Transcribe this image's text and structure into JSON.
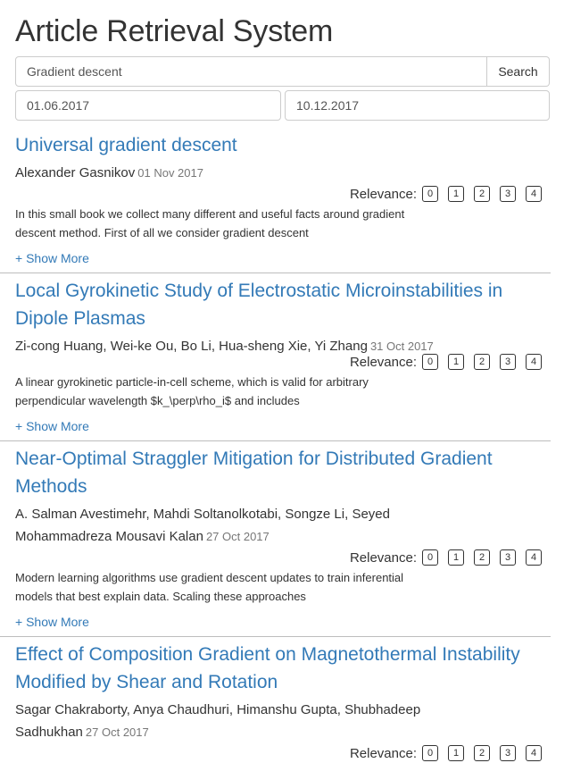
{
  "app": {
    "title": "Article Retrieval System"
  },
  "search": {
    "query": "Gradient descent",
    "button_label": "Search"
  },
  "dates": {
    "from": "01.06.2017",
    "to": "10.12.2017"
  },
  "relevance": {
    "label": "Relevance:",
    "options": [
      "0",
      "1",
      "2",
      "3",
      "4"
    ]
  },
  "results": [
    {
      "title": "Universal gradient descent",
      "authors": "Alexander Gasnikov",
      "date": "01 Nov 2017",
      "abstract": "In this small book we collect many different and useful facts around gradient descent method. First of all we consider gradient descent",
      "show_more": "+ Show More"
    },
    {
      "title": "Local Gyrokinetic Study of Electrostatic Microinstabilities in Dipole Plasmas",
      "authors": "Zi-cong Huang, Wei-ke Ou, Bo Li, Hua-sheng Xie, Yi Zhang",
      "date": "31 Oct 2017",
      "abstract": "A linear gyrokinetic particle-in-cell scheme, which is valid for arbitrary perpendicular wavelength $k_\\perp\\rho_i$ and includes",
      "show_more": "+ Show More"
    },
    {
      "title": "Near-Optimal Straggler Mitigation for Distributed Gradient Methods",
      "authors": "A. Salman Avestimehr, Mahdi Soltanolkotabi, Songze Li, Seyed Mohammadreza Mousavi Kalan",
      "date": "27 Oct 2017",
      "abstract": "Modern learning algorithms use gradient descent updates to train inferential models that best explain data. Scaling these approaches",
      "show_more": "+ Show More"
    },
    {
      "title": "Effect of Composition Gradient on Magnetothermal Instability Modified by Shear and Rotation",
      "authors": "Sagar Chakraborty, Anya Chaudhuri, Himanshu Gupta, Shubhadeep Sadhukhan",
      "date": "27 Oct 2017",
      "abstract": "",
      "show_more": ""
    }
  ]
}
